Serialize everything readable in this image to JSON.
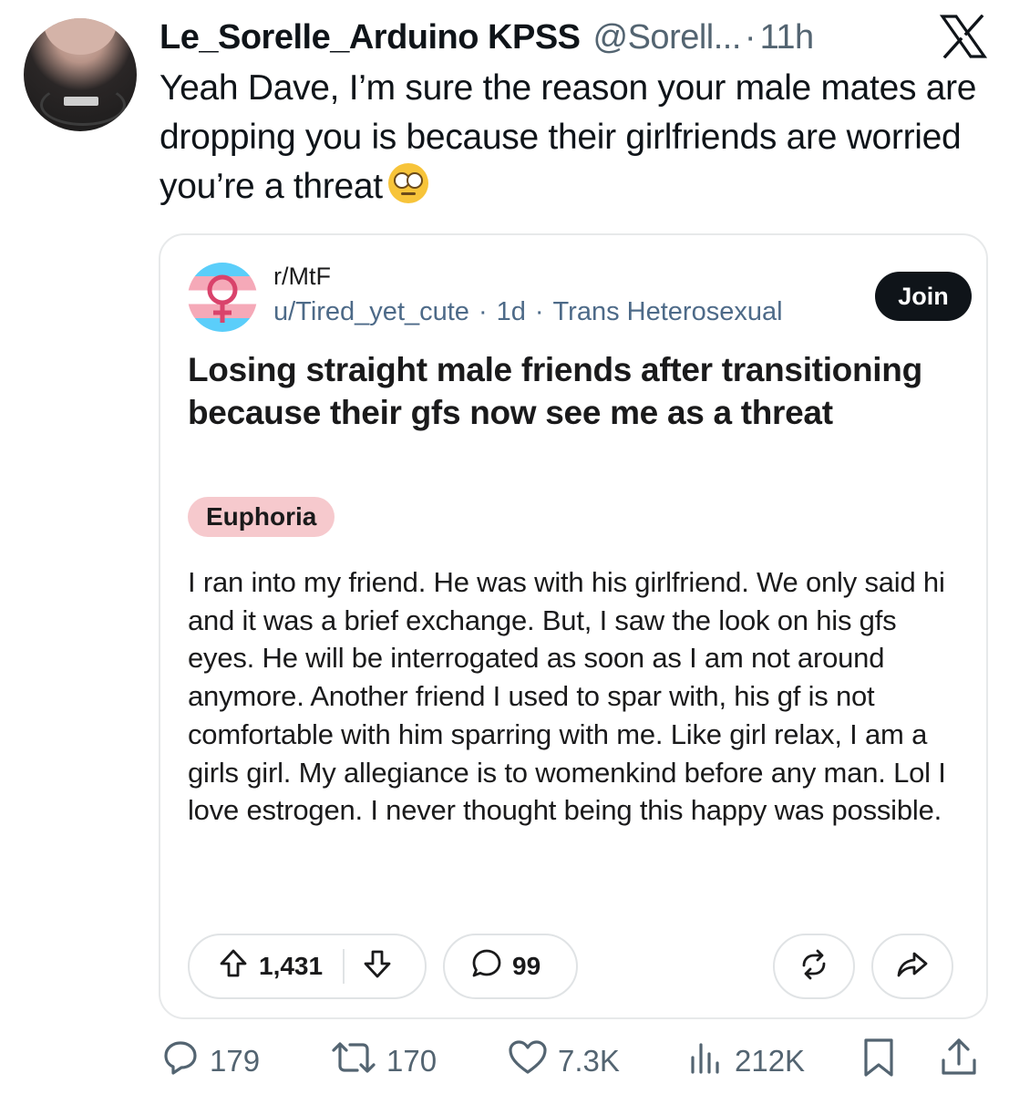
{
  "tweet": {
    "display_name": "Le_Sorelle_Arduino KPSS",
    "handle": "@Sorell...",
    "separator": "·",
    "time": "11h",
    "text": "Yeah Dave, I’m sure the reason your male mates are dropping you is because their girlfriends are worried you’re a threat",
    "emoji": "face-with-rolling-eyes"
  },
  "quoted_post": {
    "subreddit": "r/MtF",
    "user": "u/Tired_yet_cute",
    "age": "1d",
    "user_flair": "Trans Heterosexual",
    "join_label": "Join",
    "title": "Losing straight male friends after transitioning because their gfs now see me as a threat",
    "post_flair": "Euphoria",
    "body": "I ran into my friend. He was with his girlfriend. We only said hi and it was a brief exchange. But, I saw the look on his gfs eyes. He will be interrogated as soon as I am not around anymore. Another friend I used to spar with, his gf is not comfortable with him sparring with me. Like girl relax, I am a girls girl. My allegiance is to womenkind before any man. Lol I love estrogen. I never thought being this happy was possible.",
    "upvotes": "1,431",
    "comments": "99",
    "dot": "·",
    "colors": {
      "meta": "#4d6a88",
      "flair_bg": "#f6c9cd",
      "trans_blue": "#5bcefa",
      "trans_pink": "#f5a9b8"
    }
  },
  "actions": {
    "replies": "179",
    "reposts": "170",
    "likes": "7.3K",
    "views": "212K"
  }
}
